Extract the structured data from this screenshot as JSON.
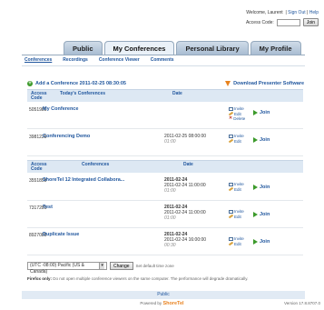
{
  "header": {
    "welcome": "Welcome, Laurent",
    "sign_out": "Sign Out",
    "help": "Help",
    "access_code_label": "Access Code:",
    "access_code_value": "",
    "join_label": "Join"
  },
  "tabs": [
    {
      "label": "Public"
    },
    {
      "label": "My Conferences"
    },
    {
      "label": "Personal Library"
    },
    {
      "label": "My Profile"
    }
  ],
  "subnav": [
    {
      "label": "Conferences"
    },
    {
      "label": "Recordings"
    },
    {
      "label": "Conference Viewer"
    },
    {
      "label": "Comments"
    }
  ],
  "add_conference": "Add a Conference 2011-02-25 08:30:05",
  "download": "Download Presenter Software",
  "today_table": {
    "headers": {
      "code": "Access Code",
      "title": "Today's Conferences",
      "date": "Date"
    },
    "rows": [
      {
        "code": "5051989",
        "name": "My Conference",
        "date_main": "",
        "date_time": "",
        "actions": [
          "Invite",
          "Edit",
          "Delete"
        ],
        "join": "Join"
      },
      {
        "code": "3981225",
        "name": "Conferencing Demo",
        "date_main": "2011-02-25 08:00:00",
        "date_time": "01:00",
        "actions": [
          "Invite",
          "Edit"
        ],
        "join": "Join"
      }
    ]
  },
  "conf_table": {
    "headers": {
      "code": "Access Code",
      "title": "Conferences",
      "date": "Date"
    },
    "rows": [
      {
        "code": "3551859",
        "name": "ShoreTel 12 Integrated Collabora...",
        "date_main": "2011-02-24",
        "date_sub": "2011-02-24 11:00:00",
        "date_time": "01:00",
        "actions": [
          "Invite",
          "Edit"
        ],
        "join": "Join"
      },
      {
        "code": "7317281",
        "name": "Test",
        "date_main": "2011-02-24",
        "date_sub": "2011-02-24 11:00:00",
        "date_time": "01:00",
        "actions": [
          "Invite",
          "Edit"
        ],
        "join": "Join"
      },
      {
        "code": "8927085",
        "name": "Duplicate Issue",
        "date_main": "2011-02-24",
        "date_sub": "2011-02-24 16:00:00",
        "date_time": "00:30",
        "actions": [
          "Invite",
          "Edit"
        ],
        "join": "Join"
      }
    ]
  },
  "timezone": {
    "selected": "(UTC -08:00) Pacific (US & Canada)",
    "change_label": "Change",
    "note": "Set default time zone"
  },
  "warning": {
    "prefix": "Firefox only:",
    "text": "Do not open multiple conference viewers on the same computer. The performance will degrade dramatically."
  },
  "footer": {
    "link": "Public",
    "powered_by": "Powered by",
    "brand": "ShoreTel",
    "version": "Version 17.8.8707.0"
  }
}
